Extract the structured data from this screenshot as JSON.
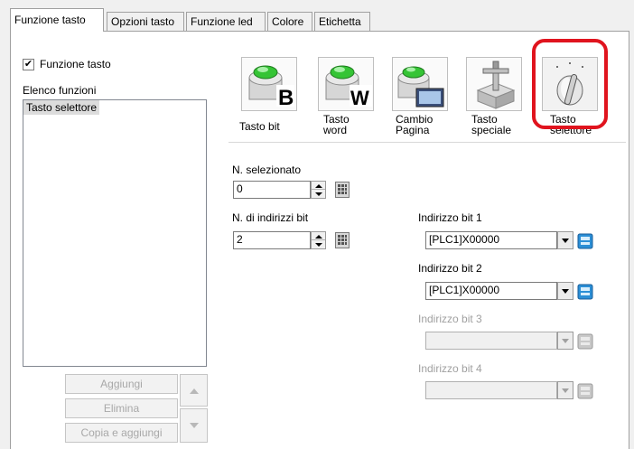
{
  "tabs": [
    {
      "label": "Funzione tasto",
      "active": true
    },
    {
      "label": "Opzioni tasto",
      "active": false
    },
    {
      "label": "Funzione led",
      "active": false
    },
    {
      "label": "Colore",
      "active": false
    },
    {
      "label": "Etichetta",
      "active": false
    }
  ],
  "left": {
    "checkbox_label": "Funzione tasto",
    "checkbox_checked": true,
    "list_title": "Elenco funzioni",
    "list_items": [
      "Tasto selettore"
    ],
    "buttons": {
      "add": "Aggiungi",
      "delete": "Elimina",
      "copy_add": "Copia e aggiungi"
    }
  },
  "key_types": [
    {
      "label_line1": "Tasto bit",
      "label_line2": "",
      "icon": "green-button-B-icon"
    },
    {
      "label_line1": "Tasto",
      "label_line2": "word",
      "icon": "green-button-W-icon"
    },
    {
      "label_line1": "Cambio",
      "label_line2": "Pagina",
      "icon": "page-change-icon"
    },
    {
      "label_line1": "Tasto",
      "label_line2": "speciale",
      "icon": "special-key-icon"
    },
    {
      "label_line1": "Tasto",
      "label_line2": "selettore",
      "icon": "selector-knob-icon",
      "selected": true
    }
  ],
  "form": {
    "selected_label": "N. selezionato",
    "selected_value": "0",
    "bit_count_label": "N. di indirizzi bit",
    "bit_count_value": "2",
    "addresses": [
      {
        "label": "Indirizzo bit 1",
        "value": "[PLC1]X00000",
        "enabled": true
      },
      {
        "label": "Indirizzo bit 2",
        "value": "[PLC1]X00000",
        "enabled": true
      },
      {
        "label": "Indirizzo bit 3",
        "value": "",
        "enabled": false
      },
      {
        "label": "Indirizzo bit 4",
        "value": "",
        "enabled": false
      }
    ]
  },
  "colors": {
    "highlight_ring": "#e0141e",
    "green_button": "#35c435",
    "selected_list_bg": "#dcdcdc",
    "disabled_text": "#a0a0a0"
  }
}
